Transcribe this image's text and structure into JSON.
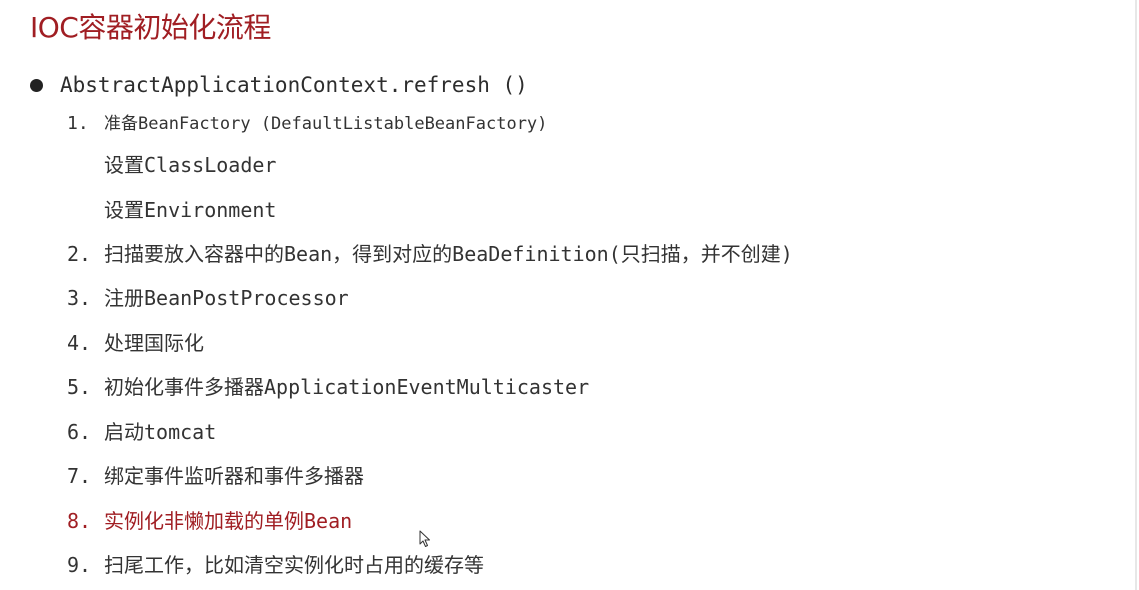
{
  "title": "IOC容器初始化流程",
  "main_method": "AbstractApplicationContext.refresh ()",
  "steps": [
    {
      "num": "1.",
      "text": "准备BeanFactory (DefaultListableBeanFactory)"
    },
    {
      "num": "2.",
      "text": "扫描要放入容器中的Bean，得到对应的BeaDefinition(只扫描，并不创建)"
    },
    {
      "num": "3.",
      "text": "注册BeanPostProcessor"
    },
    {
      "num": "4.",
      "text": "处理国际化"
    },
    {
      "num": "5.",
      "text": "初始化事件多播器ApplicationEventMulticaster"
    },
    {
      "num": "6.",
      "text": "启动tomcat"
    },
    {
      "num": "7.",
      "text": "绑定事件监听器和事件多播器"
    },
    {
      "num": "8.",
      "text": "实例化非懒加载的单例Bean"
    },
    {
      "num": "9.",
      "text": "扫尾工作，比如清空实例化时占用的缓存等"
    }
  ],
  "step1_subitems": [
    "设置ClassLoader",
    "设置Environment"
  ],
  "colors": {
    "title": "#a01e23",
    "highlight": "#a01e23",
    "text": "#333333"
  },
  "icons": {
    "bullet": "filled-circle",
    "cursor": "mouse-pointer-icon"
  }
}
